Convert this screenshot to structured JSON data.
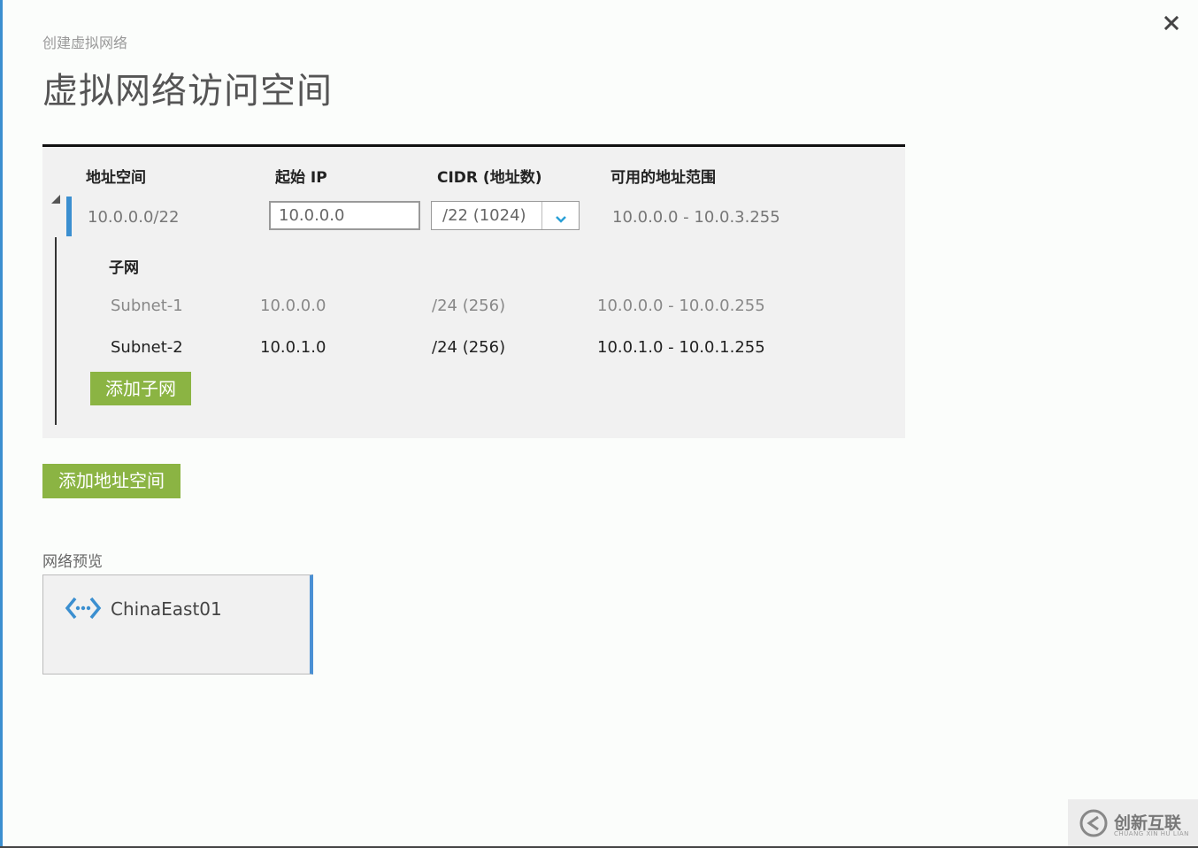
{
  "dialog": {
    "subtitle": "创建虚拟网络",
    "title": "虚拟网络访问空间",
    "close_icon": "close-icon"
  },
  "table": {
    "headers": {
      "address_space": "地址空间",
      "start_ip": "起始 IP",
      "cidr": "CIDR (地址数)",
      "range": "可用的地址范围"
    },
    "address_space": {
      "value": "10.0.0.0/22",
      "start_ip": "10.0.0.0",
      "cidr_selected": "/22 (1024)",
      "range": "10.0.0.0 - 10.0.3.255"
    },
    "subnets_label": "子网",
    "subnets": [
      {
        "name": "Subnet-1",
        "start_ip": "10.0.0.0",
        "cidr": "/24 (256)",
        "range": "10.0.0.0 - 10.0.0.255"
      },
      {
        "name": "Subnet-2",
        "start_ip": "10.0.1.0",
        "cidr": "/24 (256)",
        "range": "10.0.1.0 - 10.0.1.255"
      }
    ],
    "add_subnet_label": "添加子网"
  },
  "add_address_space_label": "添加地址空间",
  "preview": {
    "label": "网络预览",
    "network_name": "ChinaEast01",
    "icon": "virtual-network-icon"
  },
  "watermark": {
    "text": "创新互联",
    "subtext": "CHUANG XIN HU LIAN"
  },
  "colors": {
    "accent_blue": "#3b8fd0",
    "button_green": "#8bb443",
    "panel_bg": "#f1f1f1"
  }
}
